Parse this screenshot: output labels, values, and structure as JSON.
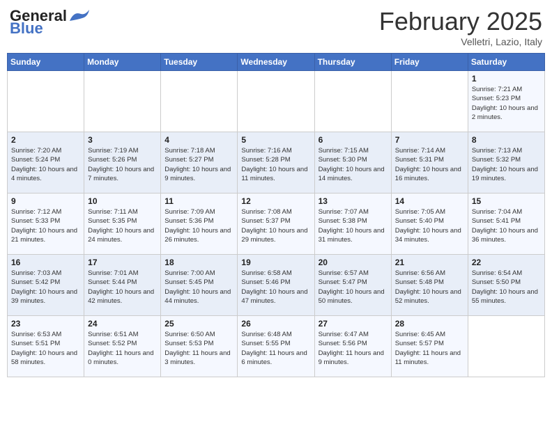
{
  "header": {
    "logo_general": "General",
    "logo_blue": "Blue",
    "month": "February 2025",
    "location": "Velletri, Lazio, Italy"
  },
  "weekdays": [
    "Sunday",
    "Monday",
    "Tuesday",
    "Wednesday",
    "Thursday",
    "Friday",
    "Saturday"
  ],
  "weeks": [
    [
      {
        "day": "",
        "info": ""
      },
      {
        "day": "",
        "info": ""
      },
      {
        "day": "",
        "info": ""
      },
      {
        "day": "",
        "info": ""
      },
      {
        "day": "",
        "info": ""
      },
      {
        "day": "",
        "info": ""
      },
      {
        "day": "1",
        "info": "Sunrise: 7:21 AM\nSunset: 5:23 PM\nDaylight: 10 hours and 2 minutes."
      }
    ],
    [
      {
        "day": "2",
        "info": "Sunrise: 7:20 AM\nSunset: 5:24 PM\nDaylight: 10 hours and 4 minutes."
      },
      {
        "day": "3",
        "info": "Sunrise: 7:19 AM\nSunset: 5:26 PM\nDaylight: 10 hours and 7 minutes."
      },
      {
        "day": "4",
        "info": "Sunrise: 7:18 AM\nSunset: 5:27 PM\nDaylight: 10 hours and 9 minutes."
      },
      {
        "day": "5",
        "info": "Sunrise: 7:16 AM\nSunset: 5:28 PM\nDaylight: 10 hours and 11 minutes."
      },
      {
        "day": "6",
        "info": "Sunrise: 7:15 AM\nSunset: 5:30 PM\nDaylight: 10 hours and 14 minutes."
      },
      {
        "day": "7",
        "info": "Sunrise: 7:14 AM\nSunset: 5:31 PM\nDaylight: 10 hours and 16 minutes."
      },
      {
        "day": "8",
        "info": "Sunrise: 7:13 AM\nSunset: 5:32 PM\nDaylight: 10 hours and 19 minutes."
      }
    ],
    [
      {
        "day": "9",
        "info": "Sunrise: 7:12 AM\nSunset: 5:33 PM\nDaylight: 10 hours and 21 minutes."
      },
      {
        "day": "10",
        "info": "Sunrise: 7:11 AM\nSunset: 5:35 PM\nDaylight: 10 hours and 24 minutes."
      },
      {
        "day": "11",
        "info": "Sunrise: 7:09 AM\nSunset: 5:36 PM\nDaylight: 10 hours and 26 minutes."
      },
      {
        "day": "12",
        "info": "Sunrise: 7:08 AM\nSunset: 5:37 PM\nDaylight: 10 hours and 29 minutes."
      },
      {
        "day": "13",
        "info": "Sunrise: 7:07 AM\nSunset: 5:38 PM\nDaylight: 10 hours and 31 minutes."
      },
      {
        "day": "14",
        "info": "Sunrise: 7:05 AM\nSunset: 5:40 PM\nDaylight: 10 hours and 34 minutes."
      },
      {
        "day": "15",
        "info": "Sunrise: 7:04 AM\nSunset: 5:41 PM\nDaylight: 10 hours and 36 minutes."
      }
    ],
    [
      {
        "day": "16",
        "info": "Sunrise: 7:03 AM\nSunset: 5:42 PM\nDaylight: 10 hours and 39 minutes."
      },
      {
        "day": "17",
        "info": "Sunrise: 7:01 AM\nSunset: 5:44 PM\nDaylight: 10 hours and 42 minutes."
      },
      {
        "day": "18",
        "info": "Sunrise: 7:00 AM\nSunset: 5:45 PM\nDaylight: 10 hours and 44 minutes."
      },
      {
        "day": "19",
        "info": "Sunrise: 6:58 AM\nSunset: 5:46 PM\nDaylight: 10 hours and 47 minutes."
      },
      {
        "day": "20",
        "info": "Sunrise: 6:57 AM\nSunset: 5:47 PM\nDaylight: 10 hours and 50 minutes."
      },
      {
        "day": "21",
        "info": "Sunrise: 6:56 AM\nSunset: 5:48 PM\nDaylight: 10 hours and 52 minutes."
      },
      {
        "day": "22",
        "info": "Sunrise: 6:54 AM\nSunset: 5:50 PM\nDaylight: 10 hours and 55 minutes."
      }
    ],
    [
      {
        "day": "23",
        "info": "Sunrise: 6:53 AM\nSunset: 5:51 PM\nDaylight: 10 hours and 58 minutes."
      },
      {
        "day": "24",
        "info": "Sunrise: 6:51 AM\nSunset: 5:52 PM\nDaylight: 11 hours and 0 minutes."
      },
      {
        "day": "25",
        "info": "Sunrise: 6:50 AM\nSunset: 5:53 PM\nDaylight: 11 hours and 3 minutes."
      },
      {
        "day": "26",
        "info": "Sunrise: 6:48 AM\nSunset: 5:55 PM\nDaylight: 11 hours and 6 minutes."
      },
      {
        "day": "27",
        "info": "Sunrise: 6:47 AM\nSunset: 5:56 PM\nDaylight: 11 hours and 9 minutes."
      },
      {
        "day": "28",
        "info": "Sunrise: 6:45 AM\nSunset: 5:57 PM\nDaylight: 11 hours and 11 minutes."
      },
      {
        "day": "",
        "info": ""
      }
    ]
  ]
}
